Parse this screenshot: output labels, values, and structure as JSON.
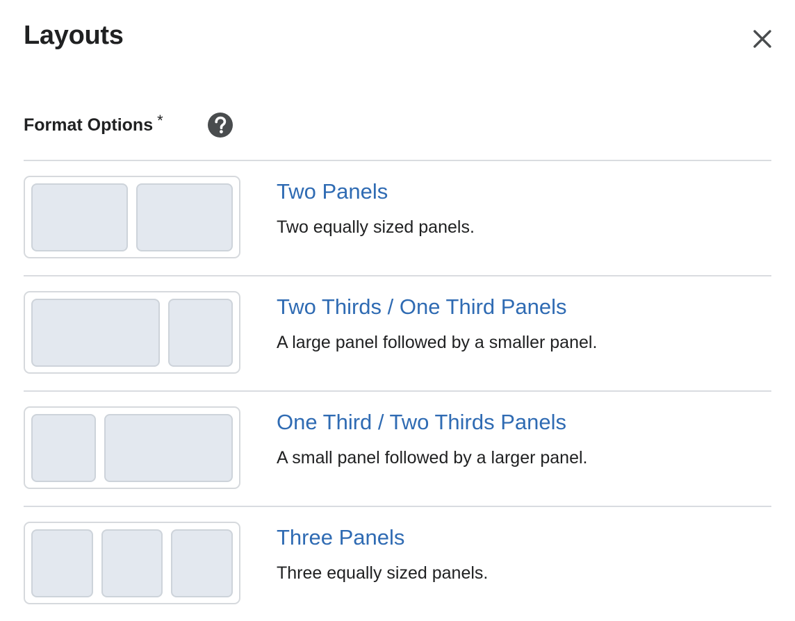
{
  "dialog": {
    "title": "Layouts",
    "close_icon": "close-icon"
  },
  "format": {
    "label": "Format Options",
    "required_mark": "*",
    "help_icon": "help-question-icon"
  },
  "options": [
    {
      "title": "Two Panels",
      "description": "Two equally sized panels.",
      "panels": [
        1,
        1
      ]
    },
    {
      "title": "Two Thirds / One Third Panels",
      "description": "A large panel followed by a smaller panel.",
      "panels": [
        2,
        1
      ]
    },
    {
      "title": "One Third / Two Thirds Panels",
      "description": "A small panel followed by a larger panel.",
      "panels": [
        1,
        2
      ]
    },
    {
      "title": "Three Panels",
      "description": "Three equally sized panels.",
      "panels": [
        1,
        1,
        1
      ]
    }
  ],
  "colors": {
    "link": "#2f6bb3",
    "text": "#202122",
    "divider": "#d9dce0",
    "panel_fill": "#e3e8ef",
    "panel_border": "#cdd3da",
    "help_icon_bg": "#494c4e"
  }
}
